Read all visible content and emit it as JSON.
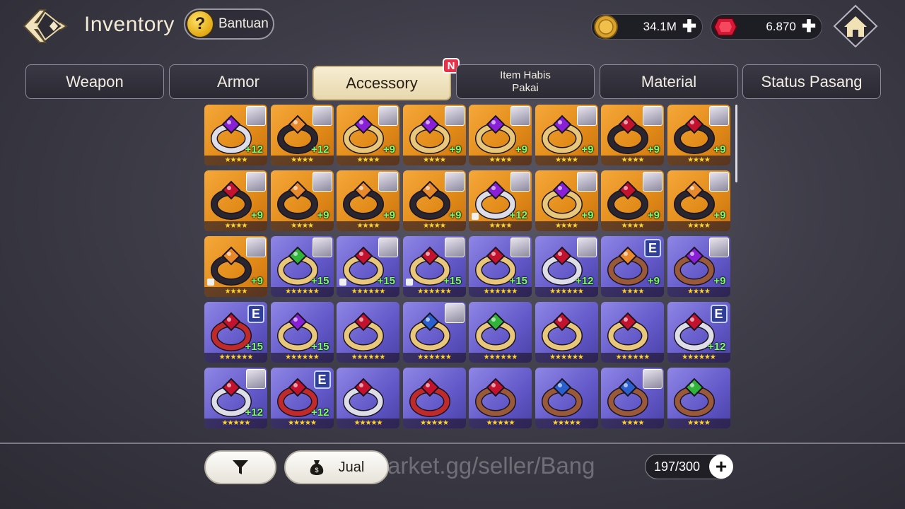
{
  "header": {
    "title": "Inventory",
    "help_label": "Bantuan",
    "help_icon": "question-mark-icon",
    "back_icon": "back-arrow-icon",
    "home_icon": "home-icon"
  },
  "currencies": {
    "gold": {
      "value": "34.1M",
      "icon": "gold-coin-icon"
    },
    "gem": {
      "value": "6.870",
      "icon": "red-gem-icon"
    }
  },
  "tabs": [
    {
      "label": "Weapon"
    },
    {
      "label": "Armor"
    },
    {
      "label": "Accessory",
      "active": true,
      "badge": "N"
    },
    {
      "label": "Item Habis\nPakai"
    },
    {
      "label": "Material"
    },
    {
      "label": "Status Pasang"
    }
  ],
  "items": [
    {
      "bg": "gold",
      "gem": "purple",
      "band": "silver",
      "plus": "+12",
      "stars": 4,
      "portrait": true
    },
    {
      "bg": "gold",
      "gem": "amber",
      "band": "dark",
      "plus": "+12",
      "stars": 4,
      "portrait": true
    },
    {
      "bg": "gold",
      "gem": "purple",
      "band": "gold",
      "plus": "+9",
      "stars": 4,
      "portrait": true
    },
    {
      "bg": "gold",
      "gem": "purple",
      "band": "gold",
      "plus": "+9",
      "stars": 4,
      "portrait": true
    },
    {
      "bg": "gold",
      "gem": "purple",
      "band": "gold",
      "plus": "+9",
      "stars": 4,
      "portrait": true
    },
    {
      "bg": "gold",
      "gem": "purple",
      "band": "gold",
      "plus": "+9",
      "stars": 4,
      "portrait": true
    },
    {
      "bg": "gold",
      "gem": "red",
      "band": "dark",
      "plus": "+9",
      "stars": 4,
      "portrait": true
    },
    {
      "bg": "gold",
      "gem": "red",
      "band": "dark",
      "plus": "+9",
      "stars": 4,
      "portrait": true
    },
    {
      "bg": "gold",
      "gem": "red",
      "band": "dark",
      "plus": "+9",
      "stars": 4,
      "portrait": true
    },
    {
      "bg": "gold",
      "gem": "amber",
      "band": "dark",
      "plus": "+9",
      "stars": 4,
      "portrait": true
    },
    {
      "bg": "gold",
      "gem": "amber",
      "band": "dark",
      "plus": "+9",
      "stars": 4,
      "portrait": true
    },
    {
      "bg": "gold",
      "gem": "amber",
      "band": "dark",
      "plus": "+9",
      "stars": 4,
      "portrait": true
    },
    {
      "bg": "gold",
      "gem": "purple",
      "band": "silver",
      "plus": "+12",
      "stars": 4,
      "portrait": true,
      "lock": true
    },
    {
      "bg": "gold",
      "gem": "purple",
      "band": "gold",
      "plus": "+9",
      "stars": 4,
      "portrait": true
    },
    {
      "bg": "gold",
      "gem": "red",
      "band": "dark",
      "plus": "+9",
      "stars": 4,
      "portrait": true
    },
    {
      "bg": "gold",
      "gem": "amber",
      "band": "dark",
      "plus": "+9",
      "stars": 4,
      "portrait": true
    },
    {
      "bg": "gold",
      "gem": "amber",
      "band": "dark",
      "plus": "+9",
      "stars": 4,
      "portrait": true,
      "lock": true
    },
    {
      "bg": "purple",
      "gem": "green",
      "band": "gold",
      "plus": "+15",
      "stars": 6,
      "portrait": true
    },
    {
      "bg": "purple",
      "gem": "red",
      "band": "gold",
      "plus": "+15",
      "stars": 6,
      "portrait": true,
      "lock": true
    },
    {
      "bg": "purple",
      "gem": "red",
      "band": "gold",
      "plus": "+15",
      "stars": 6,
      "portrait": true,
      "lock": true
    },
    {
      "bg": "purple",
      "gem": "red",
      "band": "gold",
      "plus": "+15",
      "stars": 6,
      "portrait": true
    },
    {
      "bg": "purple",
      "gem": "red",
      "band": "silver",
      "plus": "+12",
      "stars": 6,
      "portrait": true
    },
    {
      "bg": "purple",
      "gem": "amber",
      "band": "bronze",
      "plus": "+9",
      "stars": 4,
      "equip": "E"
    },
    {
      "bg": "purple",
      "gem": "purple",
      "band": "bronze",
      "plus": "+9",
      "stars": 4,
      "portrait": true
    },
    {
      "bg": "purple",
      "gem": "red",
      "band": "red",
      "plus": "+15",
      "stars": 6,
      "equip": "E"
    },
    {
      "bg": "purple",
      "gem": "purple",
      "band": "gold",
      "plus": "+15",
      "stars": 6
    },
    {
      "bg": "purple",
      "gem": "red",
      "band": "gold",
      "plus": "",
      "stars": 6
    },
    {
      "bg": "purple",
      "gem": "blue",
      "band": "gold",
      "plus": "",
      "stars": 6,
      "portrait": true
    },
    {
      "bg": "purple",
      "gem": "green",
      "band": "gold",
      "plus": "",
      "stars": 6
    },
    {
      "bg": "purple",
      "gem": "red",
      "band": "gold",
      "plus": "",
      "stars": 6
    },
    {
      "bg": "purple",
      "gem": "red",
      "band": "gold",
      "plus": "",
      "stars": 6
    },
    {
      "bg": "purple",
      "gem": "red",
      "band": "silver",
      "plus": "+12",
      "stars": 6,
      "equip": "E"
    },
    {
      "bg": "purple",
      "gem": "red",
      "band": "silver",
      "plus": "+12",
      "stars": 5,
      "portrait": true
    },
    {
      "bg": "purple",
      "gem": "red",
      "band": "red",
      "plus": "+12",
      "stars": 5,
      "equip": "E"
    },
    {
      "bg": "purple",
      "gem": "red",
      "band": "silver",
      "plus": "",
      "stars": 5
    },
    {
      "bg": "purple",
      "gem": "red",
      "band": "red",
      "plus": "",
      "stars": 5
    },
    {
      "bg": "purple",
      "gem": "red",
      "band": "bronze",
      "plus": "",
      "stars": 5
    },
    {
      "bg": "purple",
      "gem": "blue",
      "band": "bronze",
      "plus": "",
      "stars": 5
    },
    {
      "bg": "purple",
      "gem": "blue",
      "band": "bronze",
      "plus": "",
      "stars": 4,
      "portrait": true
    },
    {
      "bg": "purple",
      "gem": "green",
      "band": "bronze",
      "plus": "",
      "stars": 4
    }
  ],
  "footer": {
    "filter_icon": "filter-funnel-icon",
    "sell_icon": "money-bag-icon",
    "sell_label": "Jual",
    "watermark": "arket.gg/seller/Bang",
    "capacity": "197/300",
    "capacity_plus": "+"
  },
  "colors": {
    "gold_cell": "#e18a18",
    "purple_cell": "#6258c8",
    "plus_text": "#7dff6d",
    "star": "#ffd42a",
    "new_badge": "#e3324a"
  }
}
